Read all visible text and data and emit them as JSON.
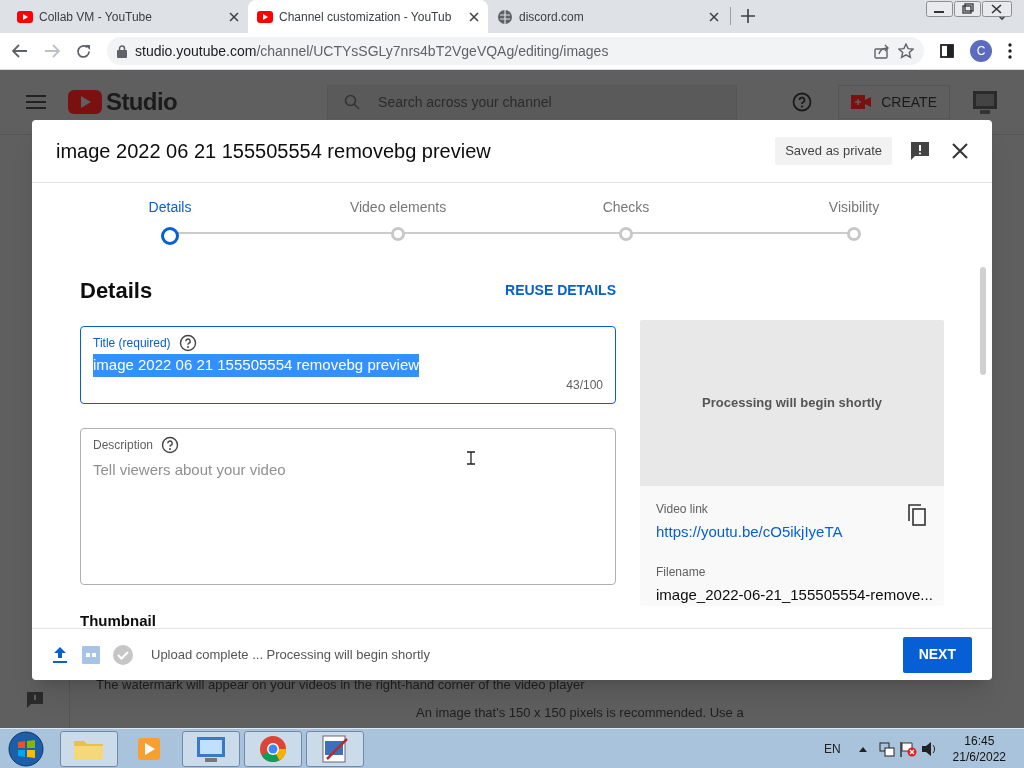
{
  "browser": {
    "tabs": [
      {
        "title": "Collab VM - YouTube",
        "kind": "youtube",
        "selected": false
      },
      {
        "title": "Channel customization - YouTub",
        "kind": "youtube",
        "selected": true
      },
      {
        "title": "discord.com",
        "kind": "globe",
        "selected": false
      }
    ],
    "address": {
      "host": "studio.youtube.com",
      "path": "/channel/UCTYsSGLy7nrs4bT2VgeVQAg/editing/images"
    },
    "profile_initial": "C"
  },
  "studio": {
    "logo": "Studio",
    "search": {
      "placeholder": "Search across your channel"
    },
    "create_label": "CREATE",
    "background_texts": [
      "The watermark will appear on your videos in the right-hand corner of the video player",
      "An image that's 150 x 150 pixels is recommended. Use a"
    ]
  },
  "dialog": {
    "title": "image 2022 06 21 155505554 removebg preview",
    "saved_badge": "Saved as private",
    "steps": [
      {
        "label": "Details",
        "selected": true
      },
      {
        "label": "Video elements",
        "selected": false
      },
      {
        "label": "Checks",
        "selected": false
      },
      {
        "label": "Visibility",
        "selected": false
      }
    ],
    "section_title": "Details",
    "reuse_link": "REUSE DETAILS",
    "title_field": {
      "label": "Title (required)",
      "value": "image 2022 06 21 155505554 removebg preview",
      "counter": "43/100"
    },
    "description_field": {
      "label": "Description",
      "placeholder": "Tell viewers about your video"
    },
    "next_section": "Thumbnail",
    "preview": {
      "message": "Processing will begin shortly",
      "link_label": "Video link",
      "link": "https://youtu.be/cO5ikjIyeTA",
      "filename_label": "Filename",
      "filename": "image_2022-06-21_155505554-remove..."
    },
    "footer": {
      "status": "Upload complete ... Processing will begin shortly",
      "next_button": "NEXT"
    }
  },
  "taskbar": {
    "language": "EN",
    "time": "16:45",
    "date": "21/6/2022"
  }
}
